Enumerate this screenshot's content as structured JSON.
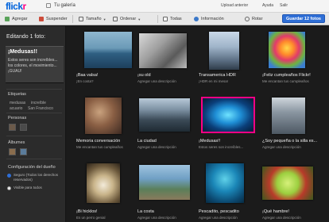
{
  "header": {
    "logo_blue": "flick",
    "logo_pink": "r",
    "gallery_link": "Tu galería",
    "upload_link": "Upload anterior",
    "help_link": "Ayuda",
    "exit_link": "Salir"
  },
  "toolbar": {
    "add": "Agregar",
    "delete": "Suspender",
    "size": "Tamaño",
    "sort": "Ordenar",
    "all": "Todas",
    "info": "Información",
    "rotate": "Rotar",
    "save": "Guardar 12 fotos"
  },
  "sidebar": {
    "editing_title": "Editando 1 foto:",
    "photo_title": "¡Medusas!!",
    "photo_desc": "Estos seres son increíbles... los colores, el movimiento... ¡GUAU!",
    "tags_label": "Etiquetas",
    "tags": [
      "medusas",
      "increíble",
      "acuario",
      "San Francisco"
    ],
    "people_label": "Personas",
    "albums_label": "Álbumes",
    "privacy_label": "Configuración del dueño",
    "privacy_option_1": "Seguro (Todos los derechos reservados)",
    "privacy_option_2": "Visible para todos"
  },
  "colors": {
    "accent": "#0063dc",
    "brand_pink": "#ff0084",
    "save_button": "#2f6fd6",
    "selection": "#ff0084"
  },
  "photos": [
    {
      "title": "¡Baa valsa!",
      "desc": "¡En costa?",
      "placeholder": false
    },
    {
      "title": "¡su old",
      "desc": "Agregar una descripción",
      "placeholder": true
    },
    {
      "title": "Transamerica HDR",
      "desc": "¡HDR en mi mesa!",
      "placeholder": false
    },
    {
      "title": "¡Feliz cumpleaños Flickr!",
      "desc": "Me encantan tus cumpleaños",
      "placeholder": false
    },
    {
      "title": "Memoria conversación",
      "desc": "Me encantan tus cumpleaños",
      "placeholder": false
    },
    {
      "title": "La ciudad",
      "desc": "Agregar una descripción",
      "placeholder": true
    },
    {
      "title": "¡Medusas!!",
      "desc": "Estos seres son increíbles...",
      "placeholder": false,
      "selected": true
    },
    {
      "title": "¿Soy pequeña o la silla es...",
      "desc": "Agregar una descripción",
      "placeholder": true
    },
    {
      "title": "¡Bi hicklos!",
      "desc": "Es un perro genial",
      "placeholder": false
    },
    {
      "title": "La costa",
      "desc": "Agregar una descripción",
      "placeholder": true
    },
    {
      "title": "Pescadito, pescadito",
      "desc": "Agregar una descripción",
      "placeholder": true
    },
    {
      "title": "¡Qué hambre!",
      "desc": "Agregar una descripción",
      "placeholder": true
    }
  ]
}
